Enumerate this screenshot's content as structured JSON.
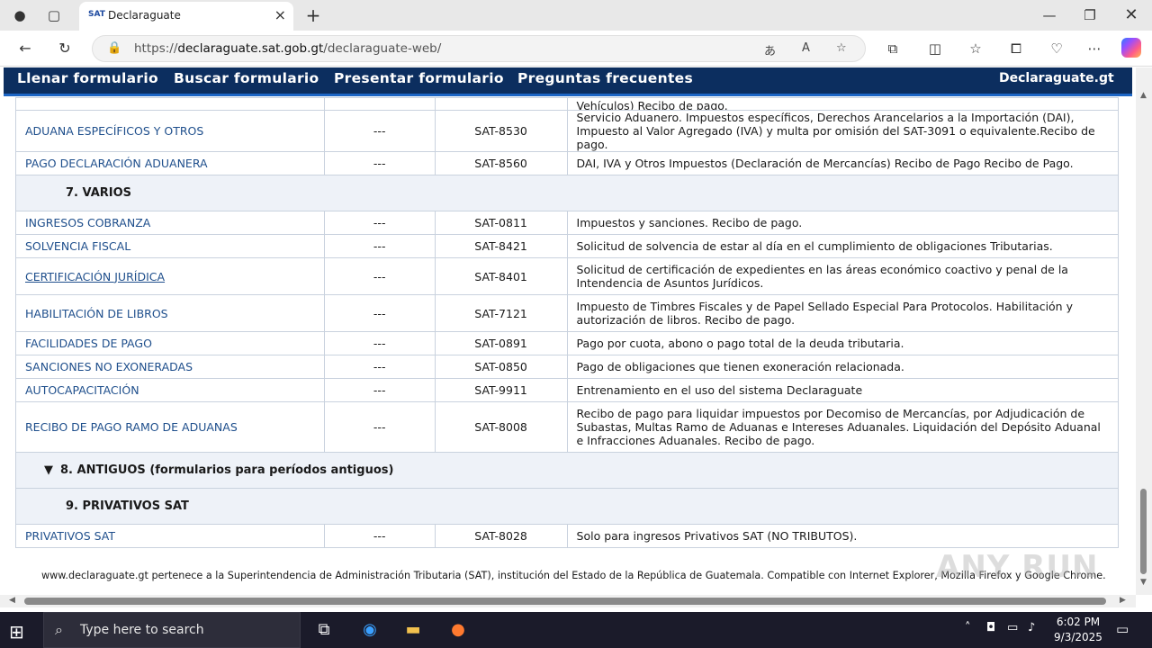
{
  "browser": {
    "tab_title": "Declaraguate",
    "tab_favicon": "SAT",
    "url_prefix": "https://",
    "url_host": "declaraguate.sat.gob.gt",
    "url_path": "/declaraguate-web/",
    "new_tab": "+"
  },
  "site": {
    "nav": [
      "Llenar formulario",
      "Buscar formulario",
      "Presentar formulario",
      "Preguntas frecuentes"
    ],
    "brand": "Declaraguate.gt",
    "partial_top_text": "Vehículos) Recibo de pago.",
    "sections": {
      "varios": "7. VARIOS",
      "antiguos": "8. ANTIGUOS (formularios para períodos antiguos)",
      "privativos": "9. PRIVATIVOS SAT",
      "antiguos_arrow": "▼"
    },
    "rows_a": [
      {
        "name": "ADUANA ESPECÍFICOS Y OTROS",
        "old": "---",
        "code": "SAT-8530",
        "desc": "Servicio Aduanero. Impuestos específicos, Derechos Arancelarios a la Importación (DAI), Impuesto al Valor Agregado (IVA) y multa por omisión del SAT-3091 o equivalente.Recibo de pago."
      },
      {
        "name": "PAGO DECLARACIÓN ADUANERA",
        "old": "---",
        "code": "SAT-8560",
        "desc": "DAI, IVA y Otros Impuestos (Declaración de Mercancías) Recibo de Pago Recibo de Pago."
      }
    ],
    "rows_b": [
      {
        "name": "INGRESOS COBRANZA",
        "old": "---",
        "code": "SAT-0811",
        "desc": "Impuestos y sanciones. Recibo de pago."
      },
      {
        "name": "SOLVENCIA FISCAL",
        "old": "---",
        "code": "SAT-8421",
        "desc": "Solicitud de solvencia de estar al día en el cumplimiento de obligaciones Tributarias."
      },
      {
        "name": "CERTIFICACIÓN JURÍDICA",
        "old": "---",
        "code": "SAT-8401",
        "desc": "Solicitud de certificación de expedientes en las áreas económico coactivo y penal de la Intendencia de Asuntos Jurídicos."
      },
      {
        "name": "HABILITACIÓN DE LIBROS",
        "old": "---",
        "code": "SAT-7121",
        "desc": "Impuesto de Timbres Fiscales y de Papel Sellado Especial Para Protocolos. Habilitación y autorización de libros. Recibo de pago."
      },
      {
        "name": "FACILIDADES DE PAGO",
        "old": "---",
        "code": "SAT-0891",
        "desc": "Pago por cuota, abono o pago total de la deuda tributaria."
      },
      {
        "name": "SANCIONES NO EXONERADAS",
        "old": "---",
        "code": "SAT-0850",
        "desc": "Pago de obligaciones que tienen exoneración relacionada."
      },
      {
        "name": "AUTOCAPACITACIÓN",
        "old": "---",
        "code": "SAT-9911",
        "desc": "Entrenamiento en el uso del sistema Declaraguate"
      },
      {
        "name": "RECIBO DE PAGO RAMO DE ADUANAS",
        "old": "---",
        "code": "SAT-8008",
        "desc": "Recibo de pago para liquidar impuestos por Decomiso de Mercancías, por Adjudicación de Subastas, Multas Ramo de Aduanas e Intereses Aduanales. Liquidación del Depósito Aduanal e Infracciones Aduanales. Recibo de pago."
      }
    ],
    "rows_c": [
      {
        "name": "PRIVATIVOS SAT",
        "old": "---",
        "code": "SAT-8028",
        "desc": "Solo para ingresos Privativos SAT (NO TRIBUTOS)."
      }
    ],
    "footer": "www.declaraguate.gt pertenece a la Superintendencia de Administración Tributaria (SAT), institución del Estado de la República de Guatemala. Compatible con Internet Explorer, Mozilla Firefox y Google Chrome.",
    "watermark": "ANY RUN"
  },
  "taskbar": {
    "search_placeholder": "Type here to search",
    "time": "6:02 PM",
    "date": "9/3/2025"
  }
}
